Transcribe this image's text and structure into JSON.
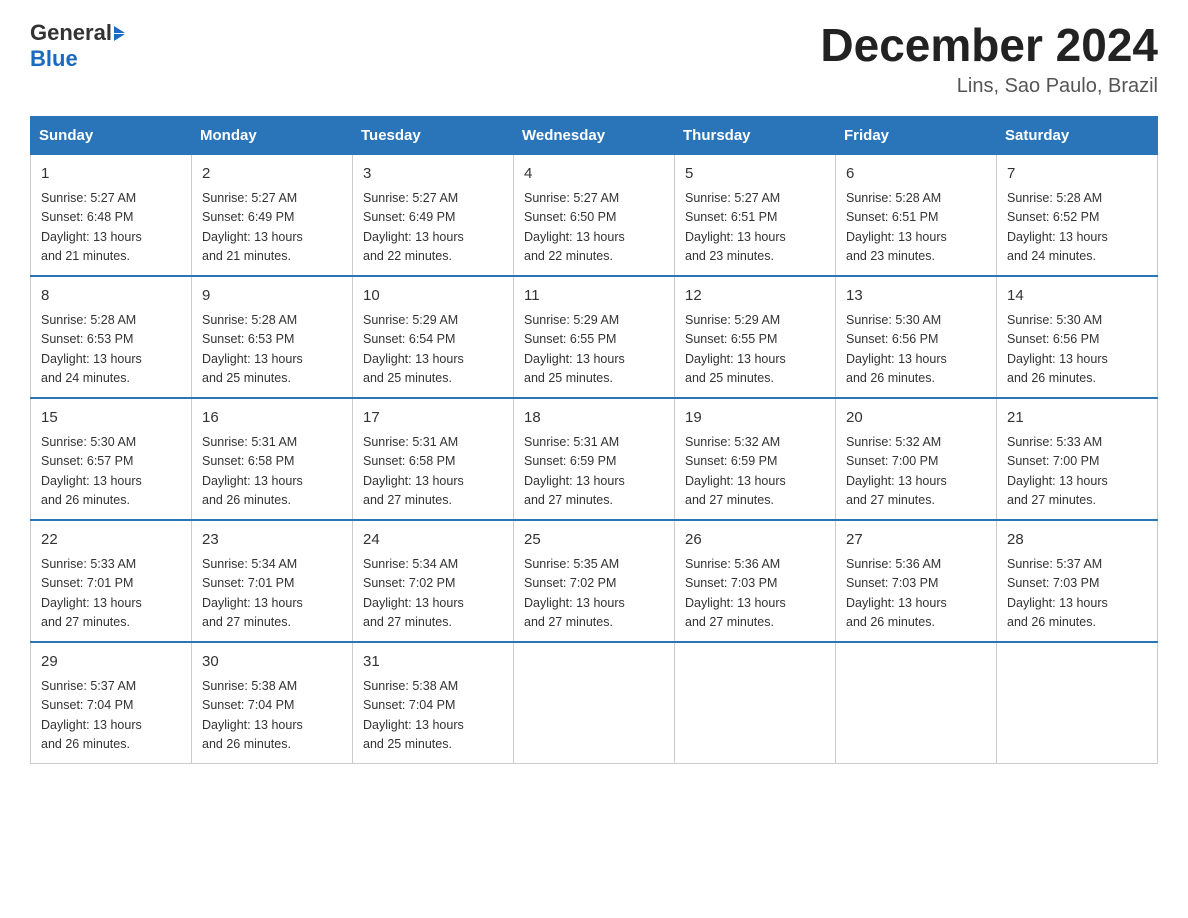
{
  "header": {
    "logo_general": "General",
    "logo_blue": "Blue",
    "title": "December 2024",
    "subtitle": "Lins, Sao Paulo, Brazil"
  },
  "days_of_week": [
    "Sunday",
    "Monday",
    "Tuesday",
    "Wednesday",
    "Thursday",
    "Friday",
    "Saturday"
  ],
  "weeks": [
    [
      {
        "day": "1",
        "sunrise": "5:27 AM",
        "sunset": "6:48 PM",
        "daylight": "13 hours and 21 minutes."
      },
      {
        "day": "2",
        "sunrise": "5:27 AM",
        "sunset": "6:49 PM",
        "daylight": "13 hours and 21 minutes."
      },
      {
        "day": "3",
        "sunrise": "5:27 AM",
        "sunset": "6:49 PM",
        "daylight": "13 hours and 22 minutes."
      },
      {
        "day": "4",
        "sunrise": "5:27 AM",
        "sunset": "6:50 PM",
        "daylight": "13 hours and 22 minutes."
      },
      {
        "day": "5",
        "sunrise": "5:27 AM",
        "sunset": "6:51 PM",
        "daylight": "13 hours and 23 minutes."
      },
      {
        "day": "6",
        "sunrise": "5:28 AM",
        "sunset": "6:51 PM",
        "daylight": "13 hours and 23 minutes."
      },
      {
        "day": "7",
        "sunrise": "5:28 AM",
        "sunset": "6:52 PM",
        "daylight": "13 hours and 24 minutes."
      }
    ],
    [
      {
        "day": "8",
        "sunrise": "5:28 AM",
        "sunset": "6:53 PM",
        "daylight": "13 hours and 24 minutes."
      },
      {
        "day": "9",
        "sunrise": "5:28 AM",
        "sunset": "6:53 PM",
        "daylight": "13 hours and 25 minutes."
      },
      {
        "day": "10",
        "sunrise": "5:29 AM",
        "sunset": "6:54 PM",
        "daylight": "13 hours and 25 minutes."
      },
      {
        "day": "11",
        "sunrise": "5:29 AM",
        "sunset": "6:55 PM",
        "daylight": "13 hours and 25 minutes."
      },
      {
        "day": "12",
        "sunrise": "5:29 AM",
        "sunset": "6:55 PM",
        "daylight": "13 hours and 25 minutes."
      },
      {
        "day": "13",
        "sunrise": "5:30 AM",
        "sunset": "6:56 PM",
        "daylight": "13 hours and 26 minutes."
      },
      {
        "day": "14",
        "sunrise": "5:30 AM",
        "sunset": "6:56 PM",
        "daylight": "13 hours and 26 minutes."
      }
    ],
    [
      {
        "day": "15",
        "sunrise": "5:30 AM",
        "sunset": "6:57 PM",
        "daylight": "13 hours and 26 minutes."
      },
      {
        "day": "16",
        "sunrise": "5:31 AM",
        "sunset": "6:58 PM",
        "daylight": "13 hours and 26 minutes."
      },
      {
        "day": "17",
        "sunrise": "5:31 AM",
        "sunset": "6:58 PM",
        "daylight": "13 hours and 27 minutes."
      },
      {
        "day": "18",
        "sunrise": "5:31 AM",
        "sunset": "6:59 PM",
        "daylight": "13 hours and 27 minutes."
      },
      {
        "day": "19",
        "sunrise": "5:32 AM",
        "sunset": "6:59 PM",
        "daylight": "13 hours and 27 minutes."
      },
      {
        "day": "20",
        "sunrise": "5:32 AM",
        "sunset": "7:00 PM",
        "daylight": "13 hours and 27 minutes."
      },
      {
        "day": "21",
        "sunrise": "5:33 AM",
        "sunset": "7:00 PM",
        "daylight": "13 hours and 27 minutes."
      }
    ],
    [
      {
        "day": "22",
        "sunrise": "5:33 AM",
        "sunset": "7:01 PM",
        "daylight": "13 hours and 27 minutes."
      },
      {
        "day": "23",
        "sunrise": "5:34 AM",
        "sunset": "7:01 PM",
        "daylight": "13 hours and 27 minutes."
      },
      {
        "day": "24",
        "sunrise": "5:34 AM",
        "sunset": "7:02 PM",
        "daylight": "13 hours and 27 minutes."
      },
      {
        "day": "25",
        "sunrise": "5:35 AM",
        "sunset": "7:02 PM",
        "daylight": "13 hours and 27 minutes."
      },
      {
        "day": "26",
        "sunrise": "5:36 AM",
        "sunset": "7:03 PM",
        "daylight": "13 hours and 27 minutes."
      },
      {
        "day": "27",
        "sunrise": "5:36 AM",
        "sunset": "7:03 PM",
        "daylight": "13 hours and 26 minutes."
      },
      {
        "day": "28",
        "sunrise": "5:37 AM",
        "sunset": "7:03 PM",
        "daylight": "13 hours and 26 minutes."
      }
    ],
    [
      {
        "day": "29",
        "sunrise": "5:37 AM",
        "sunset": "7:04 PM",
        "daylight": "13 hours and 26 minutes."
      },
      {
        "day": "30",
        "sunrise": "5:38 AM",
        "sunset": "7:04 PM",
        "daylight": "13 hours and 26 minutes."
      },
      {
        "day": "31",
        "sunrise": "5:38 AM",
        "sunset": "7:04 PM",
        "daylight": "13 hours and 25 minutes."
      },
      null,
      null,
      null,
      null
    ]
  ],
  "labels": {
    "sunrise": "Sunrise:",
    "sunset": "Sunset:",
    "daylight": "Daylight:"
  }
}
